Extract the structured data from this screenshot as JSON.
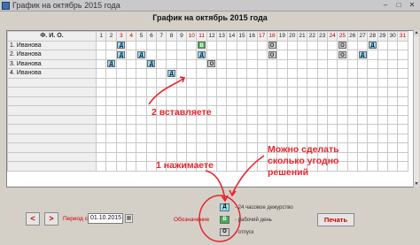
{
  "window": {
    "title": "График на октябрь 2015 года"
  },
  "heading": "График на октябрь 2015 года",
  "grid": {
    "name_header": "Ф. И. О.",
    "days": [
      "1",
      "2",
      "3",
      "4",
      "5",
      "6",
      "7",
      "8",
      "9",
      "10",
      "11",
      "12",
      "13",
      "14",
      "15",
      "16",
      "17",
      "18",
      "19",
      "20",
      "21",
      "22",
      "23",
      "24",
      "25",
      "26",
      "27",
      "28",
      "29",
      "30",
      "31"
    ],
    "weekend_days": [
      "3",
      "4",
      "10",
      "11",
      "17",
      "18",
      "24",
      "25",
      "31"
    ],
    "rows": [
      {
        "name": "1. Иванова",
        "marks": {
          "3": "Д",
          "11": "В",
          "18": "О",
          "25": "О",
          "28": "Д"
        }
      },
      {
        "name": "2. Иванова",
        "marks": {
          "3": "Д",
          "5": "Д",
          "11": "Д",
          "18": "О",
          "25": "О",
          "27": "Д"
        }
      },
      {
        "name": "3. Иванова",
        "marks": {
          "2": "Д",
          "6": "Д",
          "12": "О"
        }
      },
      {
        "name": "4. Иванова",
        "marks": {
          "8": "Д"
        }
      }
    ],
    "empty_rows": 10
  },
  "annotations": {
    "insert": "2 вставляете",
    "press": "1 нажимаете",
    "any": "Можно сделать сколько угодно решений"
  },
  "controls": {
    "prev": "<",
    "next": ">",
    "period_label": "Период с",
    "period_value": "01.10.2015",
    "print": "Печать"
  },
  "legend": {
    "title": "Обозначение",
    "items": [
      {
        "code": "Д",
        "text": "- 24 часовое дежурство"
      },
      {
        "code": "В",
        "text": "- рабочий день"
      },
      {
        "code": "О",
        "text": "- отпуск"
      }
    ]
  },
  "colors": {
    "duty": "#8fe3f0",
    "workday": "#3fb34f",
    "vacation": "#d0d0d0",
    "annotation": "#e8242e",
    "weekend_header": "#c00000"
  }
}
